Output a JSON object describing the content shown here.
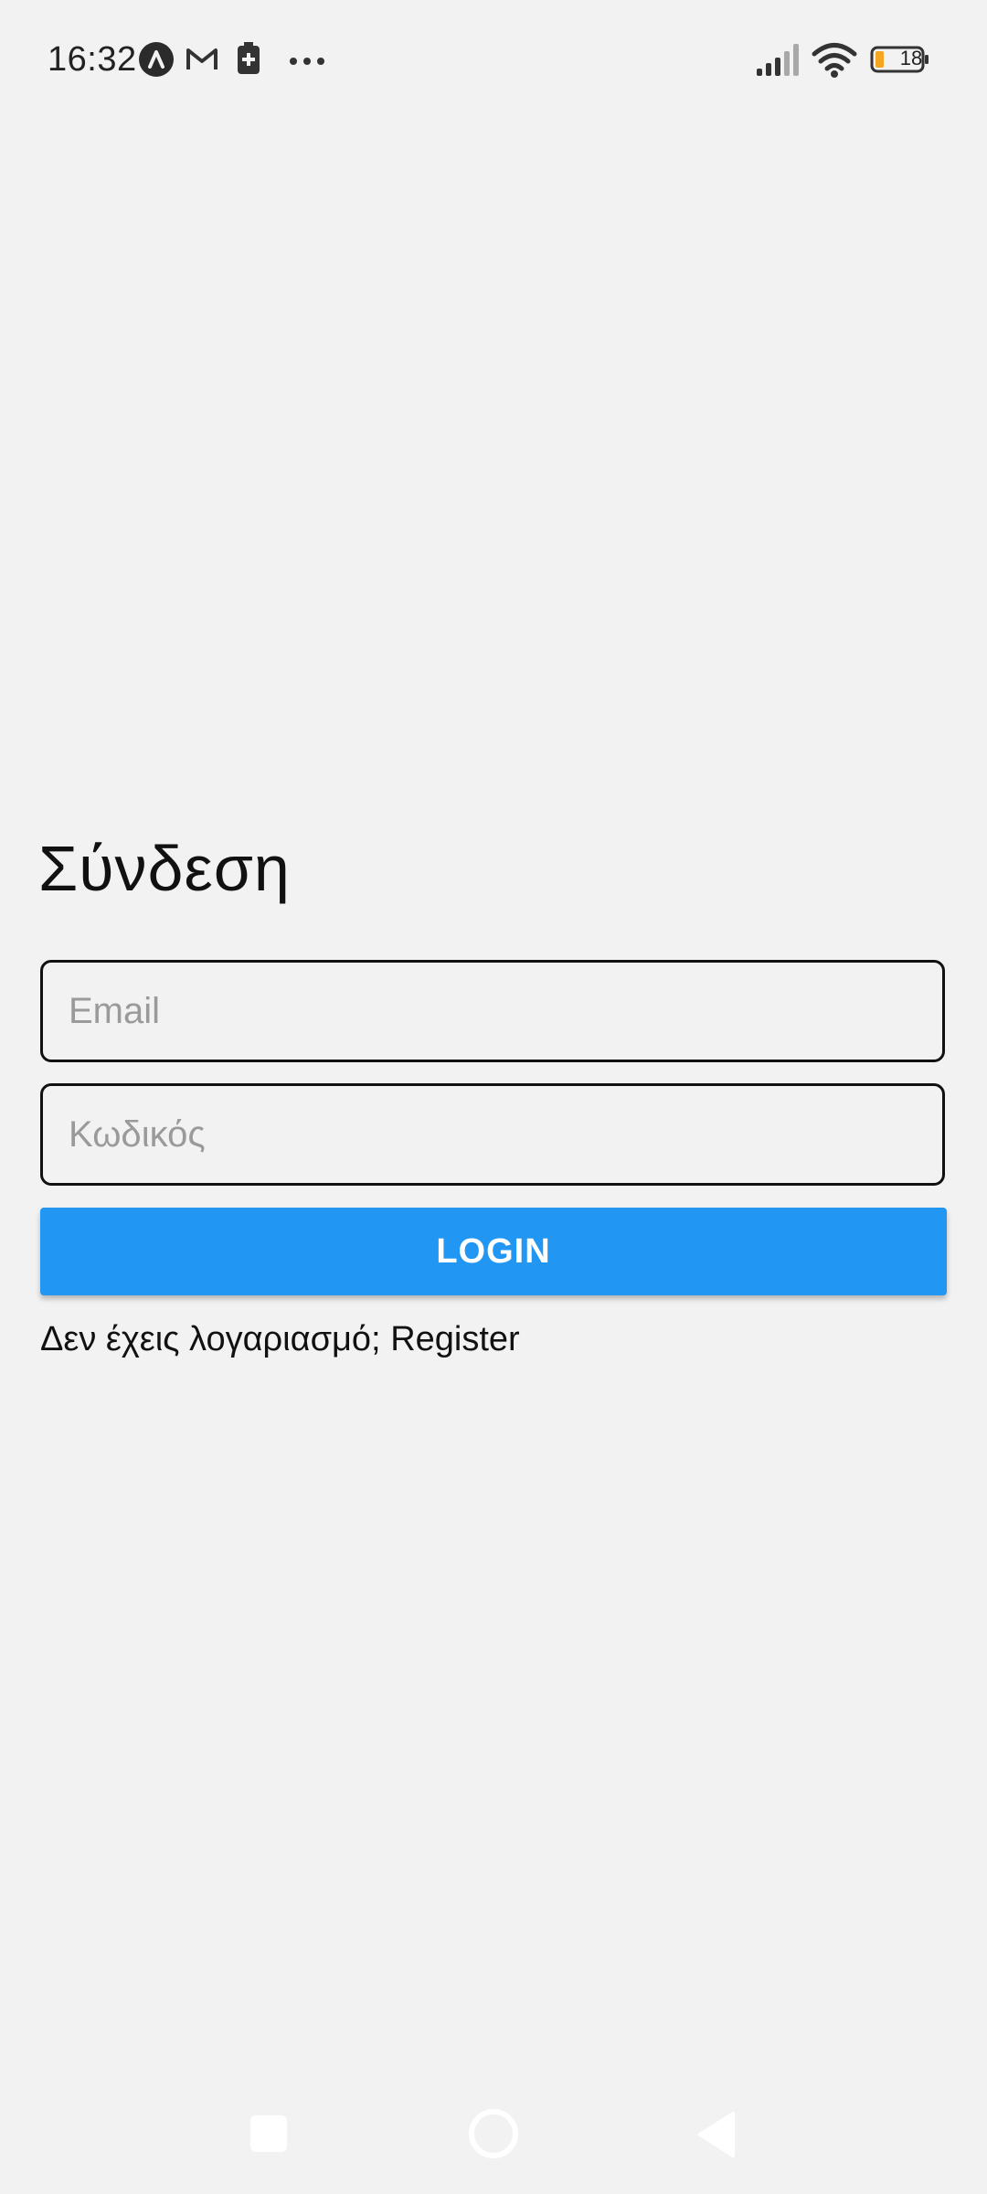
{
  "status_bar": {
    "time": "16:32",
    "battery_level": "18",
    "battery_level_fraction": 0.18,
    "icons": [
      "app-a-icon",
      "gmail-icon",
      "battery-saver-icon",
      "more-dots-icon",
      "signal-icon",
      "wifi-icon",
      "battery-icon"
    ]
  },
  "login": {
    "title": "Σύνδεση",
    "email_placeholder": "Email",
    "password_placeholder": "Κωδικός",
    "login_button": "LOGIN",
    "no_account_text": "Δεν έχεις λογαριασμό;",
    "register_link": "Register"
  },
  "nav_bar": {
    "icons": [
      "recents-icon",
      "home-icon",
      "back-icon"
    ]
  },
  "colors": {
    "background": "#f2f2f2",
    "button": "#2196f3",
    "button_text": "#ffffff",
    "battery_low": "#f5a623"
  }
}
